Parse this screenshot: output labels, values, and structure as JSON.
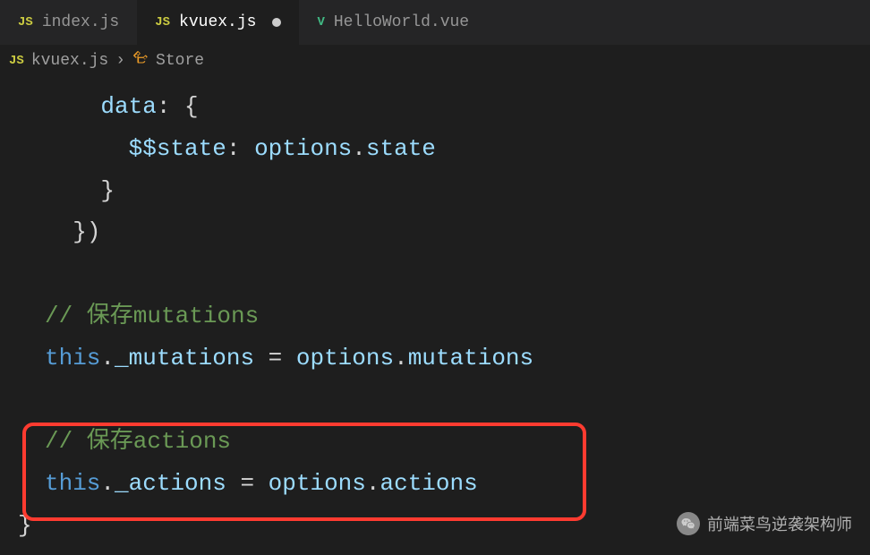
{
  "tabs": [
    {
      "icon": "JS",
      "label": "index.js",
      "active": false,
      "iconType": "js"
    },
    {
      "icon": "JS",
      "label": "kvuex.js",
      "active": true,
      "modified": true,
      "iconType": "js"
    },
    {
      "icon": "V",
      "label": "HelloWorld.vue",
      "active": false,
      "iconType": "vue"
    }
  ],
  "breadcrumb": {
    "fileIcon": "JS",
    "fileName": "kvuex.js",
    "separator": "›",
    "className": "Store"
  },
  "code": {
    "line1_indent": "    ",
    "line1_prop": "data",
    "line1_colon": ": {",
    "line2_indent": "      ",
    "line2_prop": "$$state",
    "line2_colon": ": ",
    "line2_val": "options",
    "line2_dot": ".",
    "line2_val2": "state",
    "line3_indent": "    ",
    "line3_brace": "}",
    "line4_indent": "  ",
    "line4_brace": "})",
    "comment1": "// 保存mutations",
    "line5_this": "this",
    "line5_dot1": ".",
    "line5_prop": "_mutations",
    "line5_eq": " = ",
    "line5_opt": "options",
    "line5_dot2": ".",
    "line5_prop2": "mutations",
    "comment2": "// 保存actions",
    "line6_this": "this",
    "line6_dot1": ".",
    "line6_prop": "_actions",
    "line6_eq": " = ",
    "line6_opt": "options",
    "line6_dot2": ".",
    "line6_prop2": "actions",
    "line7_brace": "}"
  },
  "watermark": {
    "text": "前端菜鸟逆袭架构师"
  }
}
